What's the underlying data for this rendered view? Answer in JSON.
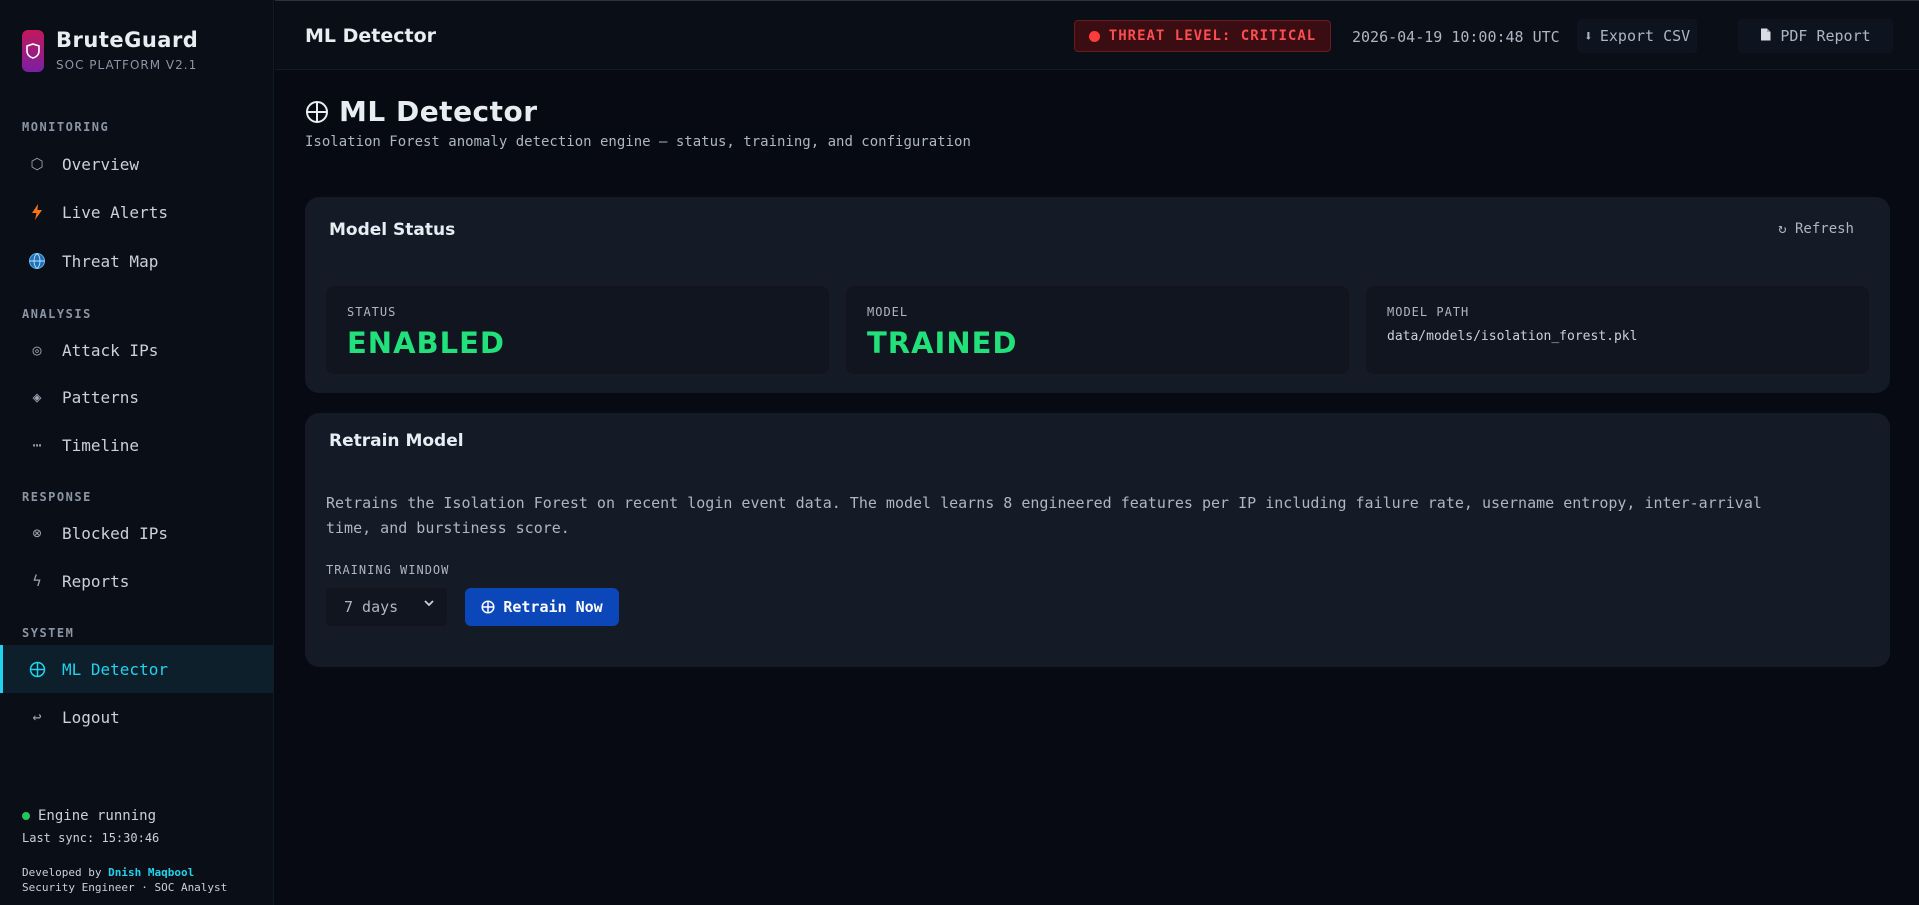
{
  "brand": {
    "title": "BruteGuard",
    "subtitle": "SOC PLATFORM V2.1"
  },
  "sidebar": {
    "sections": [
      {
        "label": "MONITORING"
      },
      {
        "label": "ANALYSIS"
      },
      {
        "label": "RESPONSE"
      },
      {
        "label": "SYSTEM"
      }
    ],
    "items": [
      {
        "label": "Overview",
        "icon": "hexagon-icon"
      },
      {
        "label": "Live Alerts",
        "icon": "lightning-icon"
      },
      {
        "label": "Threat Map",
        "icon": "globe-icon"
      },
      {
        "label": "Attack IPs",
        "icon": "target-icon"
      },
      {
        "label": "Patterns",
        "icon": "diamond-icon"
      },
      {
        "label": "Timeline",
        "icon": "ellipsis-icon"
      },
      {
        "label": "Blocked IPs",
        "icon": "blocked-icon"
      },
      {
        "label": "Reports",
        "icon": "bolt-icon"
      },
      {
        "label": "ML Detector",
        "icon": "crosshair-icon",
        "active": true
      },
      {
        "label": "Logout",
        "icon": "logout-icon"
      }
    ],
    "engine_status": "Engine running",
    "last_sync": "Last sync: 15:30:46",
    "developed_by": "Developed by",
    "developer": "Dnish Maqbool",
    "developer_role": "Security Engineer · SOC Analyst"
  },
  "topbar": {
    "title": "ML Detector",
    "threat_level": "THREAT LEVEL: CRITICAL",
    "datetime": "2026-04-19 10:00:48 UTC",
    "export_label": "Export CSV",
    "pdf_label": "PDF Report"
  },
  "page": {
    "title": "ML Detector",
    "subtitle": "Isolation Forest anomaly detection engine — status, training, and configuration"
  },
  "model_status": {
    "title": "Model Status",
    "refresh_label": "Refresh",
    "status_label": "STATUS",
    "status_value": "ENABLED",
    "model_label": "MODEL",
    "model_value": "TRAINED",
    "path_label": "MODEL PATH",
    "path_value": "data/models/isolation_forest.pkl"
  },
  "retrain": {
    "title": "Retrain Model",
    "description": "Retrains the Isolation Forest on recent login event data. The model learns 8 engineered features per IP including failure rate, username entropy, inter-arrival time, and burstiness score.",
    "window_label": "TRAINING WINDOW",
    "window_value": "7 days",
    "button_label": "Retrain Now"
  },
  "colors": {
    "accent": "#22d3ee",
    "success": "#22e07a",
    "critical": "#ff4d4f",
    "primary_button": "#0b47b8"
  }
}
